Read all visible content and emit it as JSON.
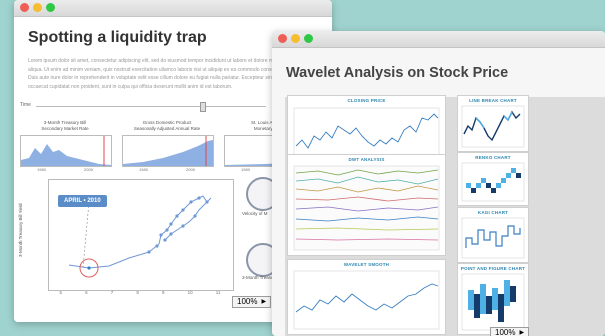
{
  "back_window": {
    "title": "Spotting a liquidity trap",
    "lorem": "Lorem ipsum dolor sit amet, consectetur adipiscing elit, sed do eiusmod tempor incididunt ut labore et dolore magna aliqua. Ut enim ad minim veniam, quis nostrud exercitation ullamco laboris nisi ut aliquip ex ea commodo consequat. Duis aute irure dolor in reprehenderit in voluptate velit esse cillum dolore eu fugiat nulla pariatur. Excepteur sint occaecat cupidatat non proident, sunt in culpa qui officia deserunt mollit anim id est laborum.",
    "time_label": "Time",
    "charts": [
      {
        "title": "3-Month Treasury Bill\nSecondary Market Rate",
        "axis": [
          "1980",
          "2000"
        ]
      },
      {
        "title": "Gross Domestic Product\nSeasonally Adjusted Annual Rate",
        "axis": [
          "1980",
          "2000"
        ]
      },
      {
        "title": "St. Louis Adjusted\nMonetary Base",
        "axis": [
          "1980",
          "2000"
        ]
      }
    ],
    "badge": "APRIL • 2010",
    "scatter_ylabel": "3-Month Treasury Bill Yield",
    "scatter_xticks": [
      "5",
      "6",
      "7",
      "8",
      "9",
      "10",
      "11"
    ],
    "gauge_labels": [
      "Velocity of M",
      "3-Month Treasury"
    ],
    "zoom": "100%"
  },
  "front_window": {
    "title": "Wavelet Analysis on Stock Price",
    "panels": {
      "closing_price": "CLOSING PRICE",
      "dwt_analysis": "DWT ANALYSIS",
      "wavelet_smooth": "WAVELET SMOOTH",
      "line_break": "LINE BREAK CHART",
      "renko": "RENKO CHART",
      "kagi": "KAGI CHART",
      "point_figure": "POINT AND FIGURE CHART"
    },
    "zoom": "100%"
  },
  "colors": {
    "background": "#9fd3cf",
    "accent": "#2d86b0",
    "series": "#3a7fc1"
  }
}
